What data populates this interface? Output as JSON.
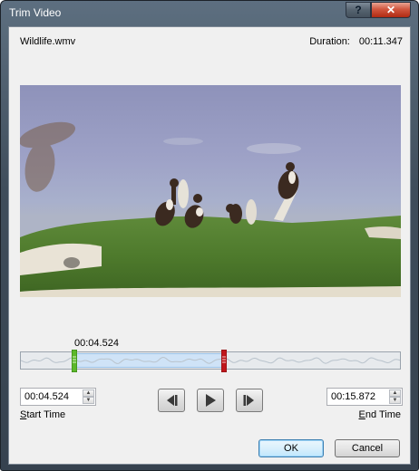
{
  "window": {
    "title": "Trim Video"
  },
  "titlebar": {
    "help_label": "?",
    "close_label": "✕"
  },
  "file": {
    "name": "Wildlife.wmv"
  },
  "duration": {
    "label": "Duration:",
    "value": "00:11.347"
  },
  "timeline": {
    "current_position": "00:04.524",
    "start_fraction": 0.142,
    "end_fraction": 0.535
  },
  "start_time": {
    "value": "00:04.524",
    "label_accel": "S",
    "label_rest": "tart Time"
  },
  "end_time": {
    "value": "00:15.872",
    "label_accel": "E",
    "label_rest": "nd Time"
  },
  "playback": {
    "previous_frame_icon": "step-back-icon",
    "play_icon": "play-icon",
    "next_frame_icon": "step-forward-icon"
  },
  "buttons": {
    "ok_label": "OK",
    "cancel_label": "Cancel"
  },
  "colors": {
    "start_marker": "#5cb82a",
    "end_marker": "#c0161c",
    "selection": "#cfe3f7"
  }
}
